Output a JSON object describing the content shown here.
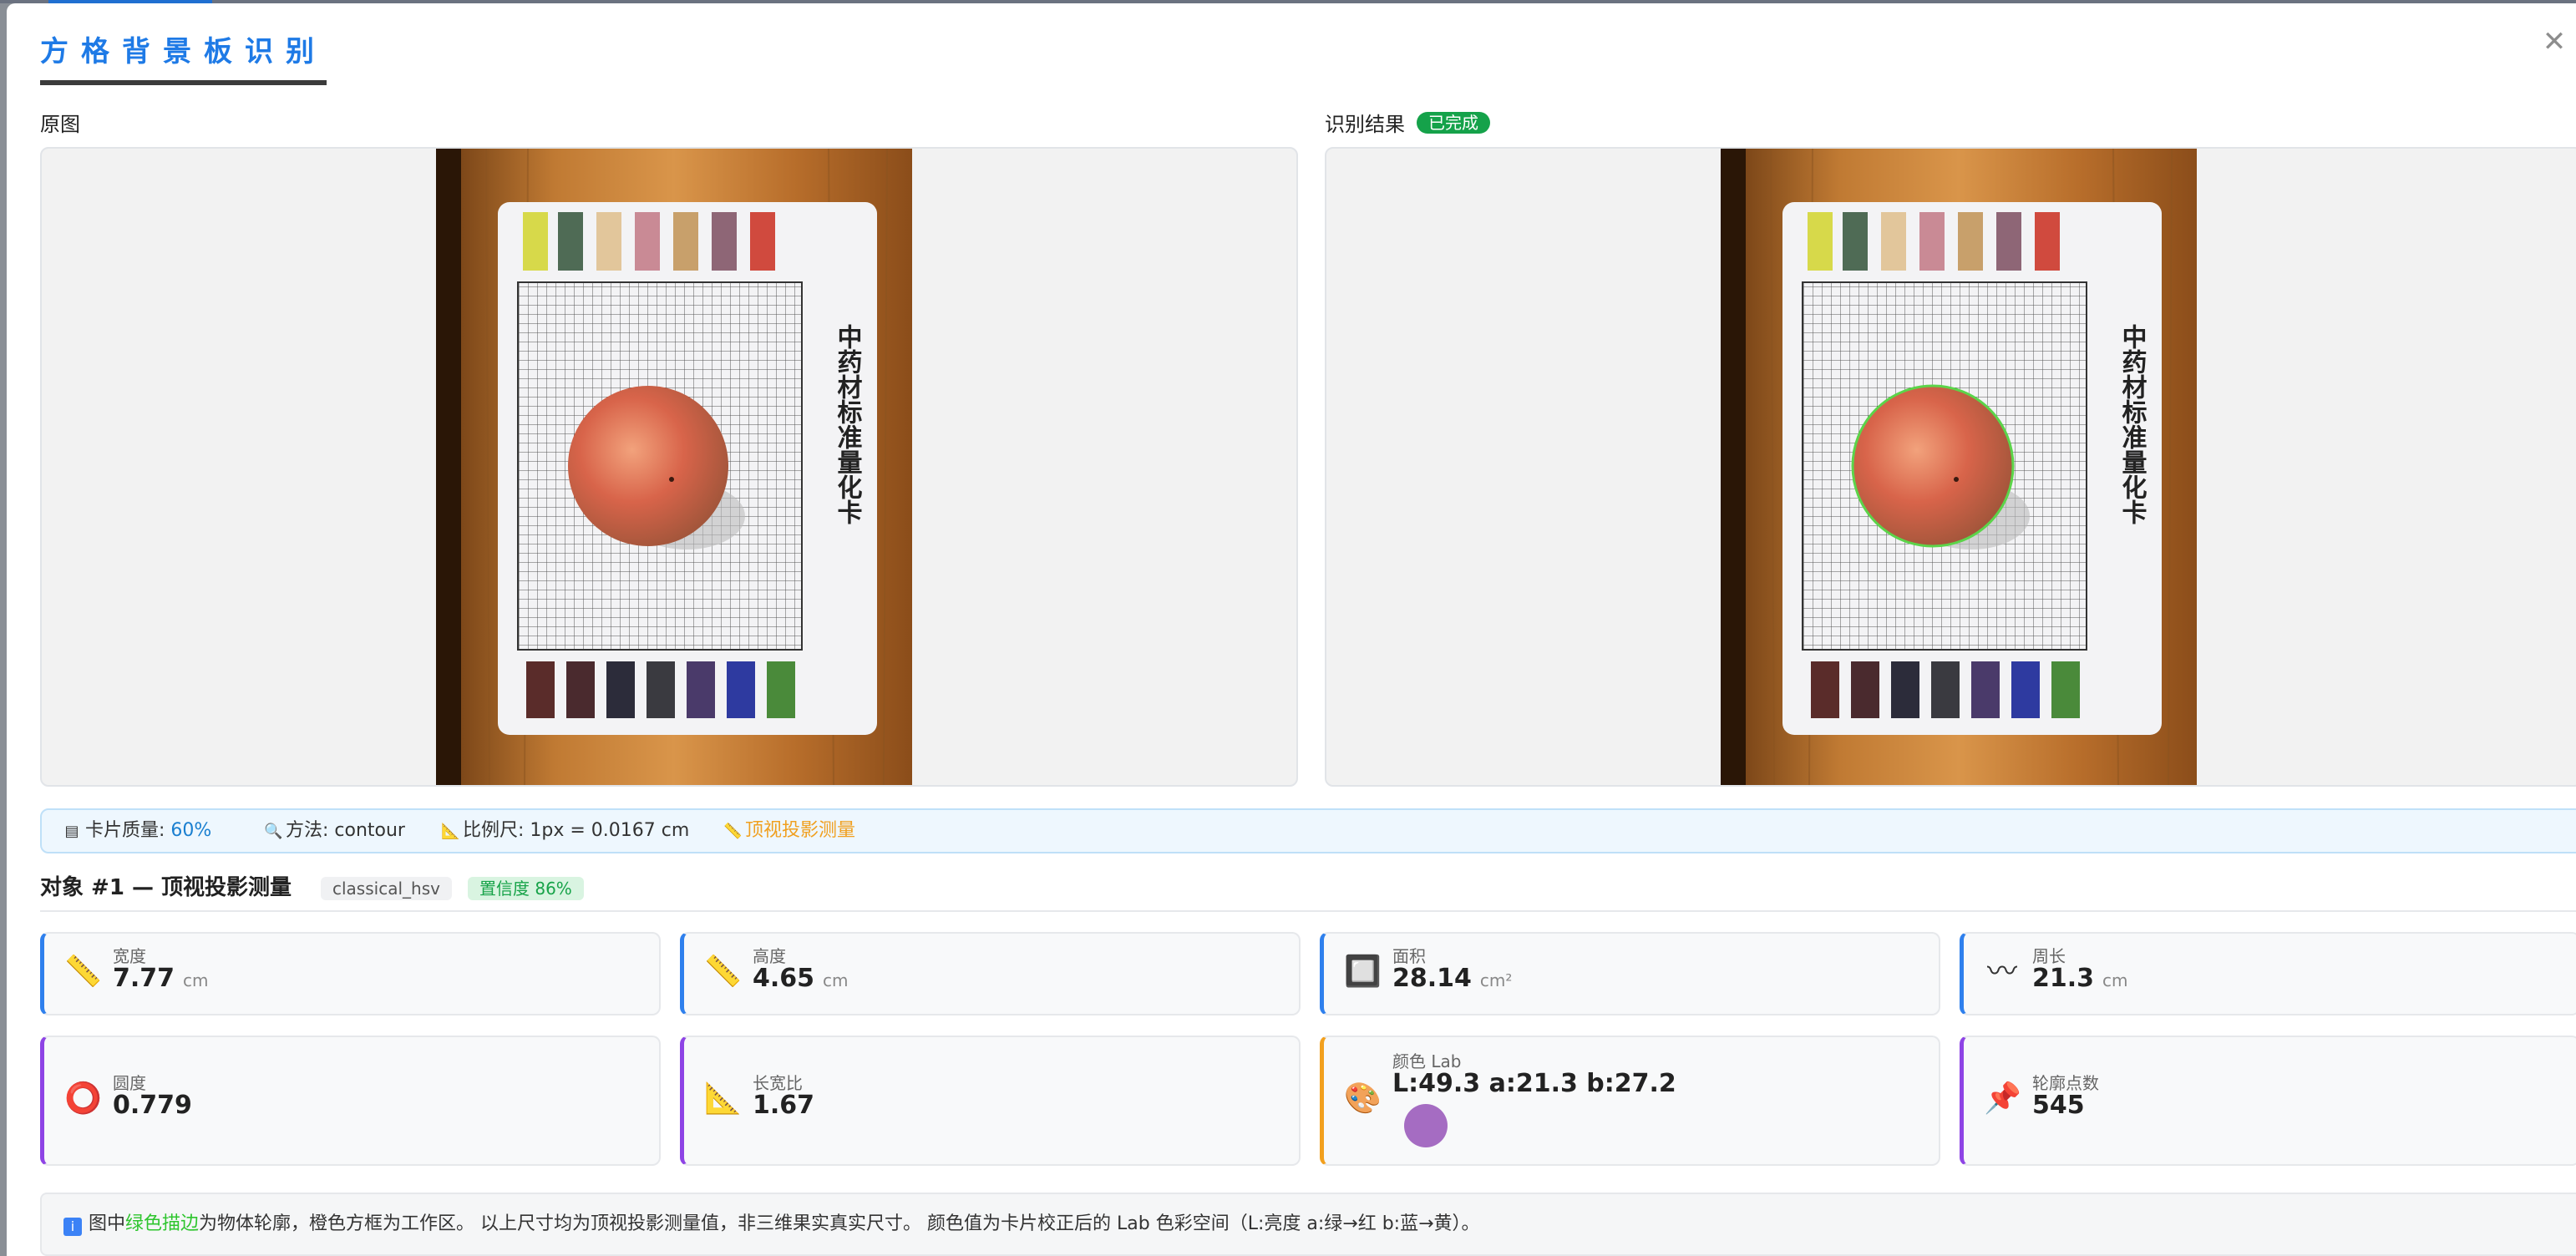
{
  "dialog": {
    "title": "方格背景板识别",
    "close_icon": "✕"
  },
  "panels": {
    "original_label": "原图",
    "result_label": "识别结果",
    "status_badge": "已完成"
  },
  "card_preview": {
    "vertical_title": "中药材标准量化卡"
  },
  "info_bar": {
    "quality_label": "卡片质量: ",
    "quality_value": "60%",
    "method_text": "方法: contour",
    "scale_text": "比例尺: 1px = 0.0167 cm",
    "mode_text": "顶视投影测量"
  },
  "object": {
    "title": "对象 #1 — 顶视投影测量",
    "algo_tag": "classical_hsv",
    "confidence_tag": "置信度 86%"
  },
  "metrics": {
    "width": {
      "label": "宽度",
      "value": "7.77",
      "unit": "cm",
      "icon": "ruler-icon"
    },
    "height": {
      "label": "高度",
      "value": "4.65",
      "unit": "cm",
      "icon": "ruler-icon"
    },
    "area": {
      "label": "面积",
      "value": "28.14",
      "unit": "cm²",
      "icon": "square-icon"
    },
    "perimeter": {
      "label": "周长",
      "value": "21.3",
      "unit": "cm",
      "icon": "wave-icon"
    },
    "circularity": {
      "label": "圆度",
      "value": "0.779",
      "icon": "circle-icon"
    },
    "aspect": {
      "label": "长宽比",
      "value": "1.67",
      "icon": "triangle-ruler-icon"
    },
    "color": {
      "label": "颜色 Lab",
      "value": "L:49.3 a:21.3 b:27.2",
      "swatch": "#a56cc2",
      "icon": "palette-icon"
    },
    "points": {
      "label": "轮廓点数",
      "value": "545",
      "icon": "pushpin-icon"
    }
  },
  "footer": {
    "prefix": "图中",
    "green_phrase": "绿色描边",
    "suffix": "为物体轮廓，橙色方框为工作区。 以上尺寸均为顶视投影测量值，非三维果实真实尺寸。 颜色值为卡片校正后的 Lab 色彩空间（L:亮度 a:绿→红 b:蓝→黄）。"
  },
  "colors": {
    "accent": "#1e7ae6",
    "success": "#15a24a",
    "contour": "#5cd44a",
    "card_blue": "#2f80ed",
    "card_purple": "#8e44e5",
    "card_orange": "#f2a01e"
  }
}
